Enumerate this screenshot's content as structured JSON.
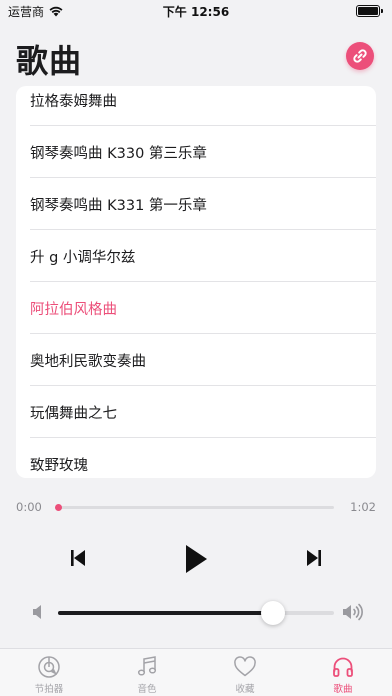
{
  "status_bar": {
    "carrier": "运营商",
    "time": "下午 12:56"
  },
  "header": {
    "title": "歌曲"
  },
  "songs": [
    {
      "title": "拉格泰姆舞曲"
    },
    {
      "title": "钢琴奏鸣曲 K330 第三乐章"
    },
    {
      "title": "钢琴奏鸣曲 K331 第一乐章"
    },
    {
      "title": "升 g 小调华尔兹"
    },
    {
      "title": "阿拉伯风格曲"
    },
    {
      "title": "奥地利民歌变奏曲"
    },
    {
      "title": "玩偶舞曲之七"
    },
    {
      "title": "致野玫瑰"
    }
  ],
  "active_song_index": 4,
  "player": {
    "current_time": "0:00",
    "total_time": "1:02",
    "progress": 0.0,
    "volume": 0.78
  },
  "tabs": [
    {
      "label": "节拍器",
      "icon": "metronome-icon"
    },
    {
      "label": "音色",
      "icon": "music-note-icon"
    },
    {
      "label": "收藏",
      "icon": "heart-icon"
    },
    {
      "label": "歌曲",
      "icon": "headphones-icon"
    }
  ],
  "active_tab_index": 3,
  "colors": {
    "accent": "#ec4f7a",
    "background": "#f2f2f4",
    "card": "#ffffff"
  }
}
